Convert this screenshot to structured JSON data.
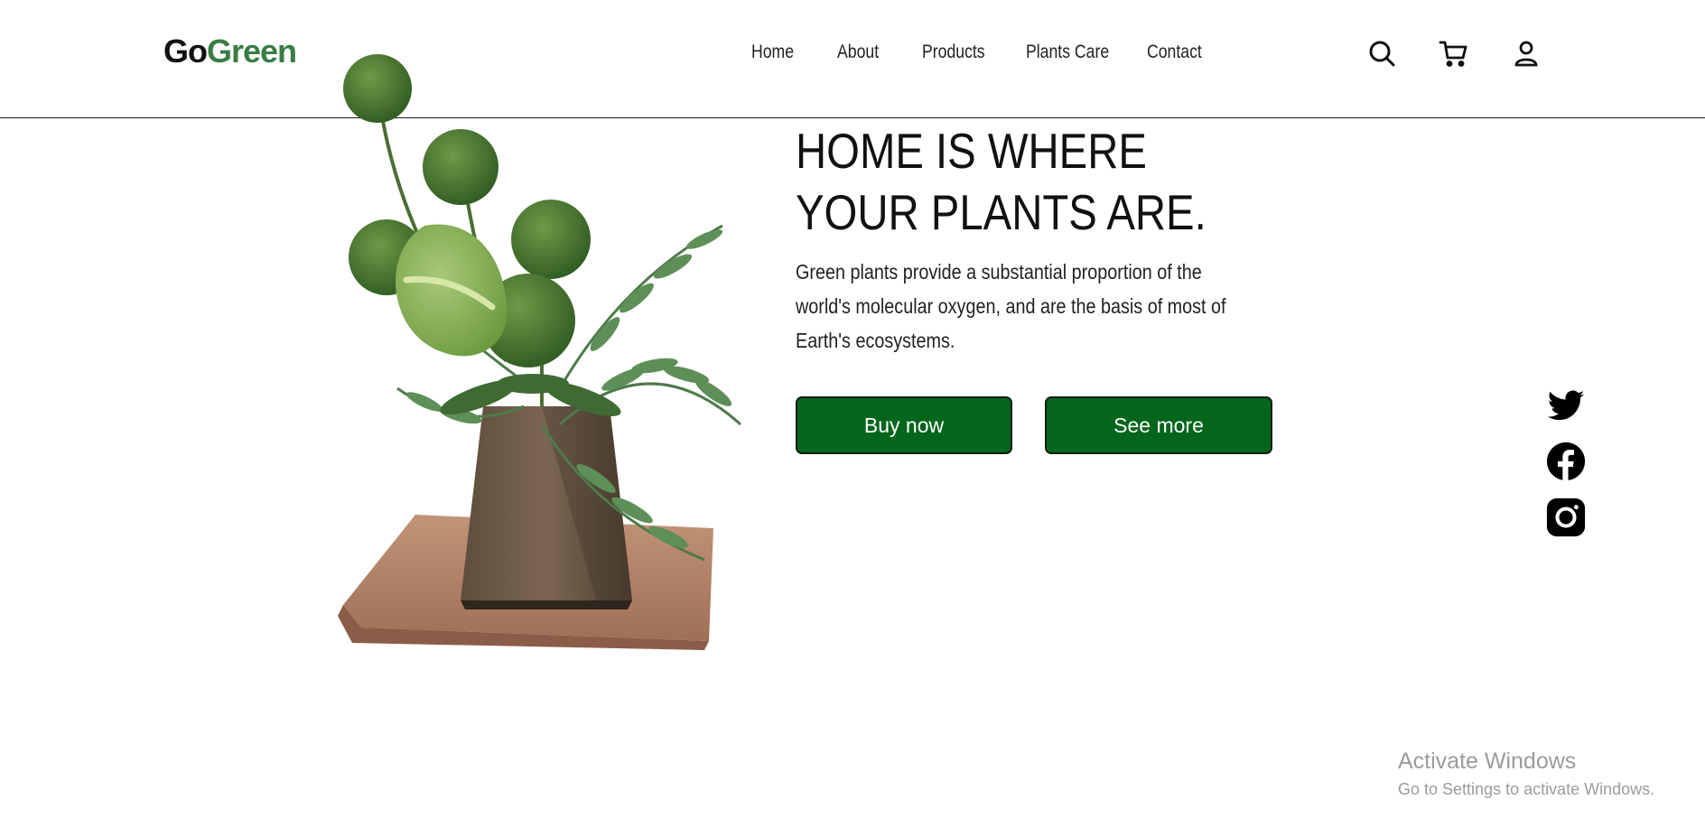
{
  "brand": {
    "go": "Go",
    "green": "Green",
    "accent": "#3a7d44"
  },
  "nav": {
    "items": [
      {
        "label": "Home"
      },
      {
        "label": "About"
      },
      {
        "label": "Products"
      },
      {
        "label": "Plants Care"
      },
      {
        "label": "Contact"
      }
    ]
  },
  "header_icons": [
    "search-icon",
    "cart-icon",
    "user-icon"
  ],
  "hero": {
    "title_line1": "HOME IS WHERE",
    "title_line2": "YOUR PLANTS ARE.",
    "description": "Green plants provide a substantial proportion of the world's molecular oxygen, and are the basis of most of Earth's ecosystems.",
    "buy_label": "Buy now",
    "more_label": "See more",
    "button_color": "#04661c"
  },
  "social": [
    "twitter-icon",
    "facebook-icon",
    "instagram-icon"
  ],
  "watermark": {
    "title": "Activate Windows",
    "subtitle": "Go to Settings to activate Windows."
  }
}
